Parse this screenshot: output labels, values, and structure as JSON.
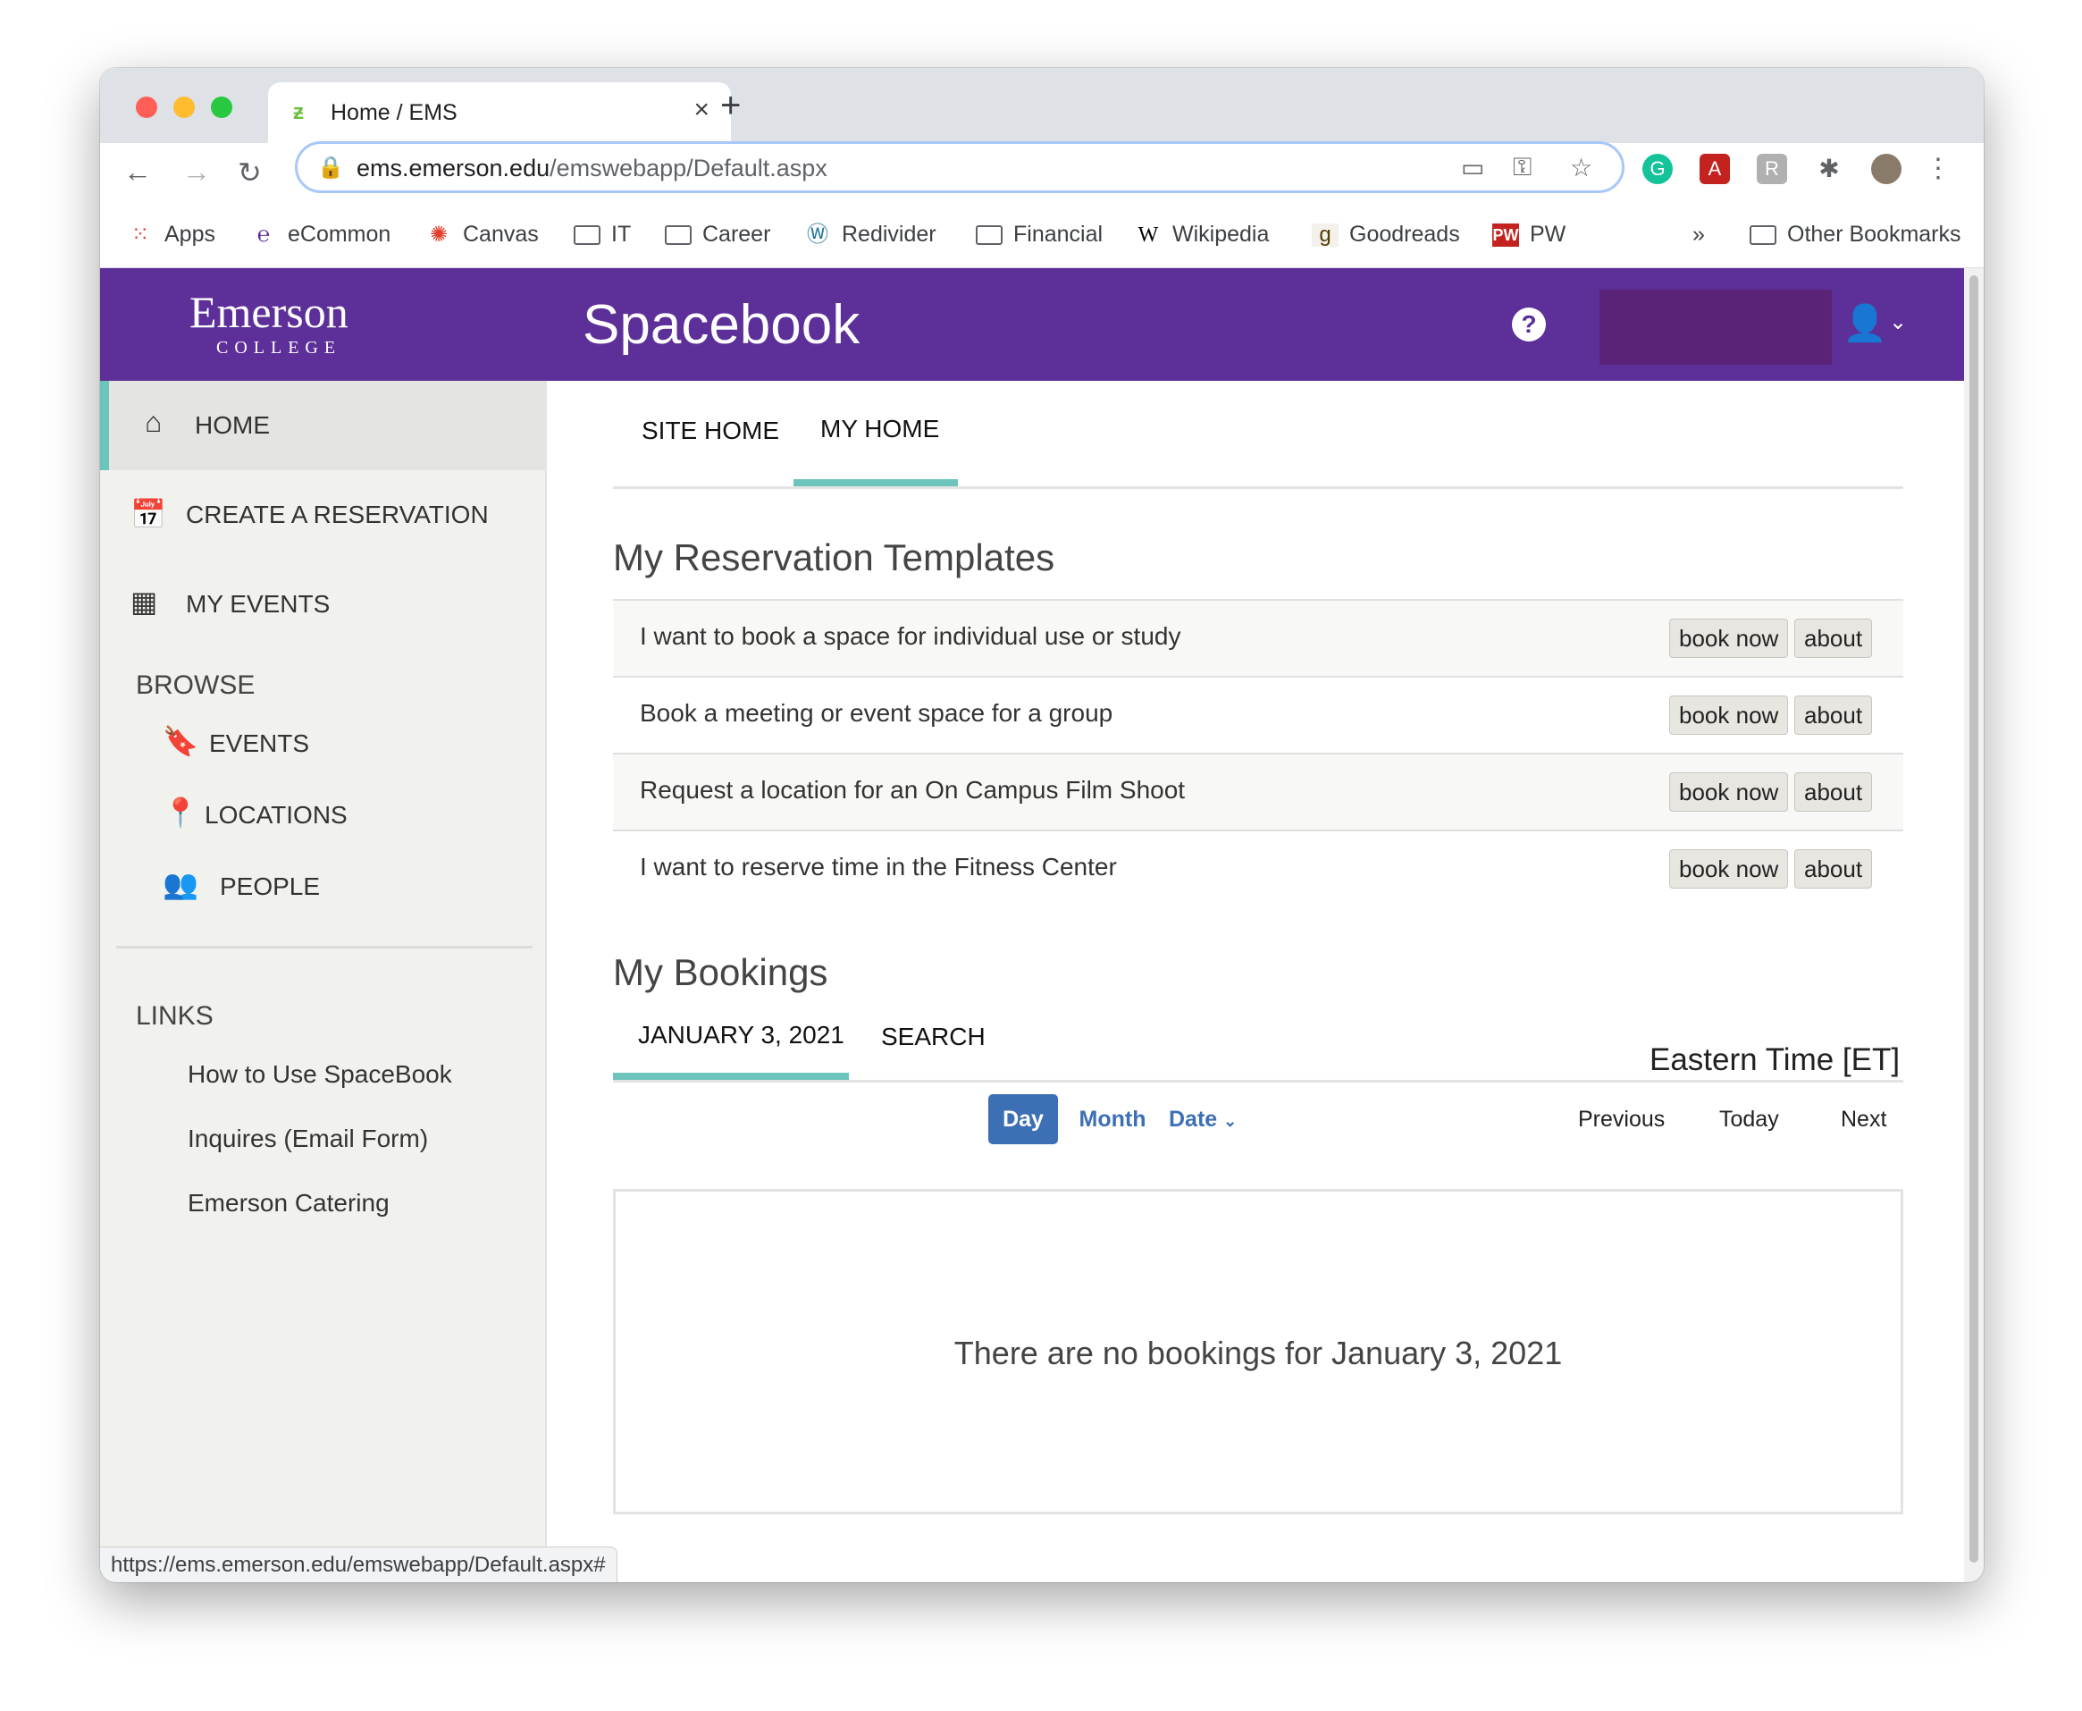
{
  "browser": {
    "tab_title": "Home / EMS",
    "url_domain": "ems.emerson.edu",
    "url_path": "/emswebapp/Default.aspx",
    "status_url": "https://ems.emerson.edu/emswebapp/Default.aspx#",
    "bookmarks": [
      "Apps",
      "eCommon",
      "Canvas",
      "IT",
      "Career",
      "Redivider",
      "Financial",
      "Wikipedia",
      "Goodreads",
      "PW"
    ],
    "other_bookmarks": "Other Bookmarks",
    "overflow": "»"
  },
  "header": {
    "logo_main": "Emerson",
    "logo_sub": "COLLEGE",
    "app_title": "Spacebook",
    "help": "?"
  },
  "sidebar": {
    "home": "HOME",
    "create": "CREATE A RESERVATION",
    "my_events": "MY EVENTS",
    "browse_title": "BROWSE",
    "browse": [
      "EVENTS",
      "LOCATIONS",
      "PEOPLE"
    ],
    "links_title": "LINKS",
    "links": [
      "How to Use SpaceBook",
      "Inquires (Email Form)",
      "Emerson Catering"
    ]
  },
  "main": {
    "tabs": [
      "SITE HOME",
      "MY HOME"
    ],
    "templates_heading": "My Reservation Templates",
    "templates": [
      "I want to book a space for individual use or study",
      "Book a meeting or event space for a group",
      "Request a location for an On Campus Film Shoot",
      "I want to reserve time in the Fitness Center"
    ],
    "book_now": "book now",
    "about": "about",
    "bookings_heading": "My Bookings",
    "booking_tabs": [
      "JANUARY 3, 2021",
      "SEARCH"
    ],
    "timezone": "Eastern Time [ET]",
    "views": [
      "Day",
      "Month",
      "Date"
    ],
    "nav": [
      "Previous",
      "Today",
      "Next"
    ],
    "empty_message": "There are no bookings for January 3, 2021"
  },
  "colors": {
    "brand_purple": "#5d2f98",
    "accent_teal": "#6cc4bc",
    "day_button": "#3d6fb4"
  }
}
